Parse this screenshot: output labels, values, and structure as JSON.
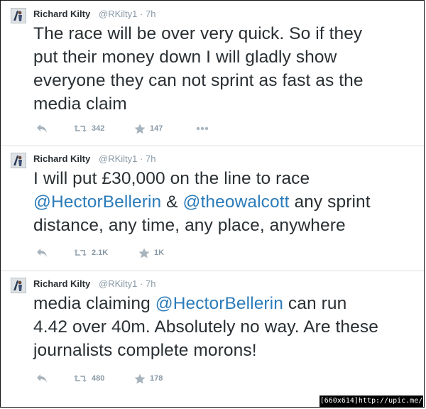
{
  "tweets": [
    {
      "name": "Richard Kilty",
      "handle": "@RKilty1",
      "sep": "·",
      "time": "7h",
      "lines": [
        [
          {
            "t": "The race will be over very quick. So if they"
          }
        ],
        [
          {
            "t": "put their money down I will gladly show"
          }
        ],
        [
          {
            "t": "everyone they can not sprint as fast as the"
          }
        ],
        [
          {
            "t": "media claim"
          }
        ]
      ],
      "retweets": "342",
      "favorites": "147"
    },
    {
      "name": "Richard Kilty",
      "handle": "@RKilty1",
      "sep": "·",
      "time": "7h",
      "lines": [
        [
          {
            "t": "I will put £30,000 on the line to race"
          }
        ],
        [
          {
            "t": "@HectorBellerin",
            "m": true
          },
          {
            "t": " & "
          },
          {
            "t": "@theowalcott",
            "m": true
          },
          {
            "t": " any sprint"
          }
        ],
        [
          {
            "t": "distance, any time, any place, anywhere"
          }
        ]
      ],
      "retweets": "2.1K",
      "favorites": "1K"
    },
    {
      "name": "Richard Kilty",
      "handle": "@RKilty1",
      "sep": "·",
      "time": "7h",
      "lines": [
        [
          {
            "t": "media claiming "
          },
          {
            "t": "@HectorBellerin",
            "m": true
          },
          {
            "t": " can run"
          }
        ],
        [
          {
            "t": "4.42 over 40m. Absolutely no way. Are these"
          }
        ],
        [
          {
            "t": "journalists complete morons!"
          }
        ]
      ],
      "retweets": "480",
      "favorites": "178"
    }
  ],
  "icons": {
    "reply": "reply-icon",
    "retweet": "retweet-icon",
    "favorite": "star-icon",
    "more": "more-icon"
  },
  "colors": {
    "text": "#292f33",
    "muted": "#8899a6",
    "link": "#2b7bb9",
    "divider": "#d8dee2"
  },
  "watermark": "[660x614]http://upic.me/"
}
